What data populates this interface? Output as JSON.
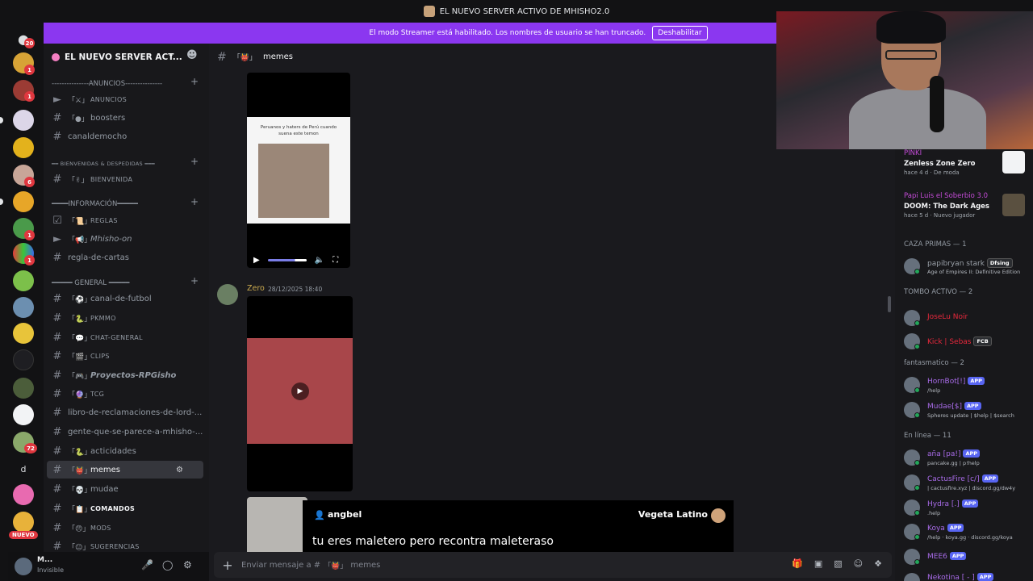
{
  "window": {
    "title": "EL NUEVO SERVER ACTIVO DE MHISHO2.0"
  },
  "banner": {
    "text": "El modo Streamer está habilitado. Los nombres de usuario se han truncado.",
    "button": "Deshabilitar"
  },
  "guild_rail": {
    "badges": [
      "20",
      "1",
      "1",
      "6",
      "1",
      "1",
      "72"
    ],
    "dm_letter": "d",
    "new_label": "NUEVO"
  },
  "server": {
    "name": "EL NUEVO SERVER ACT..."
  },
  "channels": {
    "cat_anuncios": "---------------ANUNCIOS---------------",
    "anuncios": "ANUNCIOS",
    "boosters": "boosters",
    "canaldemocho": "canaldemocho",
    "cat_bienvenidas": "━━ BIENVENIDAS & DESPEDIDAS ━━━",
    "bienvenida": "BIENVENIDA",
    "cat_informacion": "━━━━INFORMACIÓN━━━━━",
    "reglas": "REGLAS",
    "mhisho_on": "Mhisho-on",
    "regla_de_cartas": "regla-de-cartas",
    "cat_general": "━━━━━ GENERAL ━━━━━",
    "canal_de_futbol": "canal-de-futbol",
    "pkmmo": "PKMMO",
    "chat_general": "CHAT-GENERAL",
    "clips": "CLIPS",
    "proyectos": "Proyectos-RPGisho",
    "tcg": "TCG",
    "libro": "libro-de-reclamaciones-de-lord-...",
    "gente": "gente-que-se-parece-a-mhisho-...",
    "acticidades": "acticidades",
    "memes": "memes",
    "mudae": "mudae",
    "comandos": "COMANDOS",
    "mods": "MODS",
    "sugerencias": "SUGERENCIAS"
  },
  "user_panel": {
    "name": "M...",
    "status": "Invisible"
  },
  "chat": {
    "channel": "memes",
    "video1_caption": "Peruanos y haters de Perú cuando suena este temon",
    "message": {
      "author": "Zero",
      "timestamp": "28/12/2025 18:40"
    },
    "composer_placeholder": "Enviar mensaje a #",
    "composer_channel": "memes"
  },
  "subtitle": {
    "user": "angbel",
    "reward": "Vegeta Latino",
    "text": "tu eres maletero pero recontra maleteraso"
  },
  "members": {
    "activities": [
      {
        "name": "PINKI",
        "game": "Zenless Zone Zero",
        "status": "hace 4 d",
        "extra": "De moda"
      },
      {
        "name": "Papi Luis el Soberbio 3.0",
        "game": "DOOM: The Dark Ages",
        "status": "hace 5 d",
        "extra": "Nuevo jugador"
      }
    ],
    "groups": [
      {
        "title": "CAZA PRIMAS — 1",
        "members": [
          {
            "name": "papibryan stark",
            "tag": "Dfsing",
            "status": "Age of Empires II: Definitive Edition",
            "color": "#9aa0a8"
          }
        ]
      },
      {
        "title": "TOMBO ACTIVO — 2",
        "members": [
          {
            "name": "JoseLu Noir",
            "tag": "",
            "status": "",
            "color": "#e8283c"
          },
          {
            "name": "Kick | Sebas",
            "tag": "FCB",
            "status": "",
            "color": "#e8283c"
          }
        ]
      },
      {
        "title": "fantasmatico — 2",
        "members": [
          {
            "name": "HornBot[!]",
            "tag": "APP",
            "status": "/help",
            "color": "#a86be8"
          },
          {
            "name": "Mudae[$]",
            "tag": "APP",
            "status": "Spheres update | $help | $search",
            "color": "#a86be8"
          }
        ]
      },
      {
        "title": "En línea — 11",
        "members": [
          {
            "name": "aña [pa!]",
            "tag": "APP",
            "status": "pancake.gg | p!help",
            "color": "#a86be8"
          },
          {
            "name": "CactusFire [c/]",
            "tag": "APP",
            "status": "| cactusfire.xyz | discord.gg/dw4y",
            "color": "#a86be8"
          },
          {
            "name": "Hydra [.]",
            "tag": "APP",
            "status": ".help",
            "color": "#a86be8"
          },
          {
            "name": "Koya",
            "tag": "APP",
            "status": "/help · koya.gg · discord.gg/koya",
            "color": "#a86be8"
          },
          {
            "name": "MEE6",
            "tag": "APP",
            "status": "",
            "color": "#a86be8"
          },
          {
            "name": "Nekotina [ - ]",
            "tag": "APP",
            "status": "/help · nekotina.com",
            "color": "#a86be8"
          }
        ]
      }
    ]
  }
}
